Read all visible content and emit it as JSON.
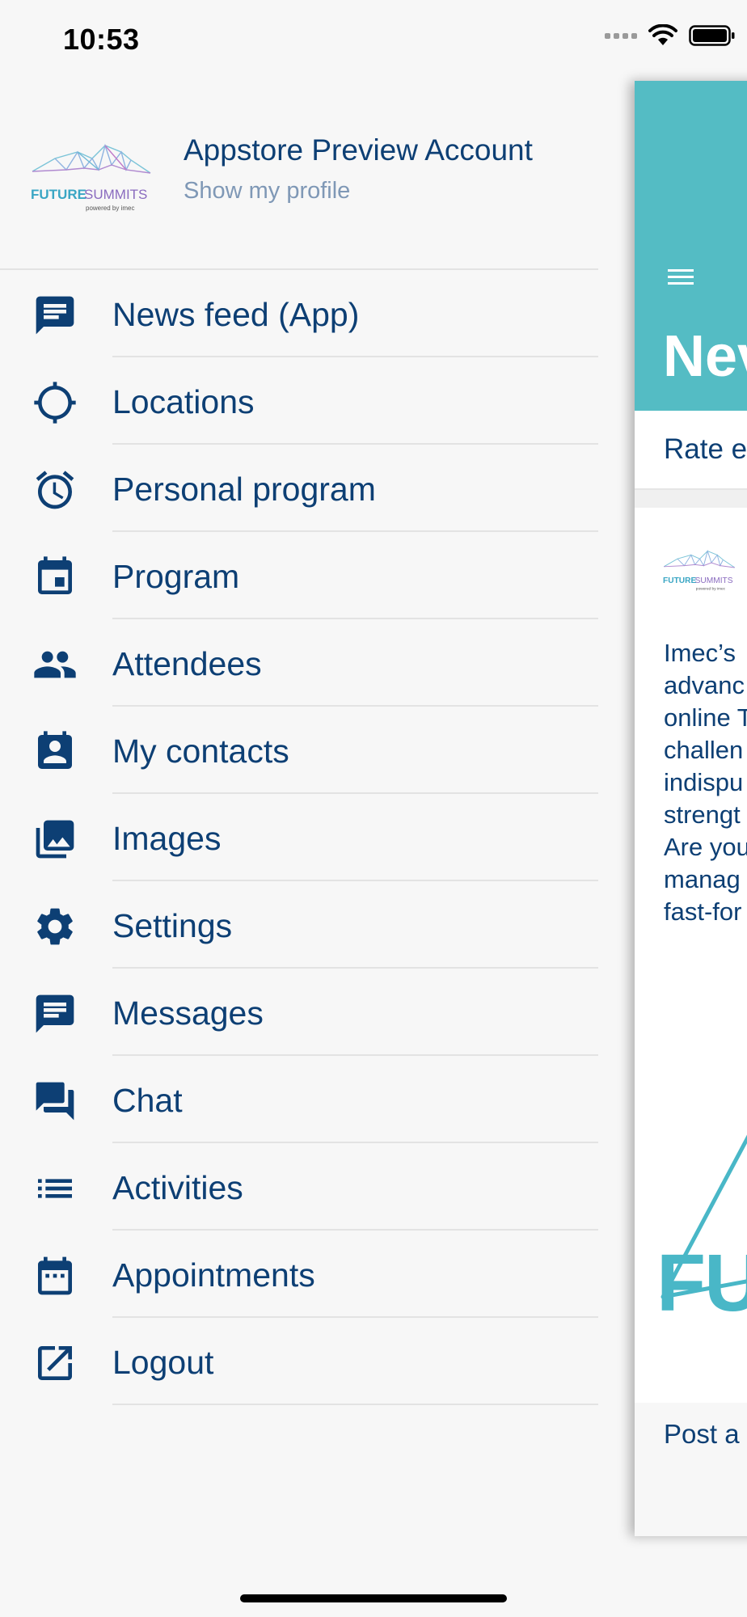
{
  "status_bar": {
    "time": "10:53"
  },
  "profile": {
    "name": "Appstore Preview Account",
    "link": "Show my profile",
    "logo_text": "FUTURESUMMITS",
    "logo_sub": "powered by imec"
  },
  "menu": [
    {
      "label": "News feed (App)",
      "icon": "news-feed-icon"
    },
    {
      "label": "Locations",
      "icon": "crosshair-icon"
    },
    {
      "label": "Personal program",
      "icon": "alarm-clock-icon"
    },
    {
      "label": "Program",
      "icon": "calendar-event-icon"
    },
    {
      "label": "Attendees",
      "icon": "people-icon"
    },
    {
      "label": "My contacts",
      "icon": "contact-card-icon"
    },
    {
      "label": "Images",
      "icon": "images-icon"
    },
    {
      "label": "Settings",
      "icon": "gear-icon"
    },
    {
      "label": "Messages",
      "icon": "message-icon"
    },
    {
      "label": "Chat",
      "icon": "chat-icon"
    },
    {
      "label": "Activities",
      "icon": "list-icon"
    },
    {
      "label": "Appointments",
      "icon": "calendar-icon"
    },
    {
      "label": "Logout",
      "icon": "external-link-icon"
    }
  ],
  "main_panel": {
    "title": "Nev",
    "subtab": "Rate e",
    "post_text": [
      "Imec’s",
      "advanc",
      "online T",
      "challen",
      "indispu",
      "strengt",
      "Are you",
      "manag",
      "fast-for"
    ],
    "post_big": "FU",
    "post_action": "Post a"
  },
  "colors": {
    "accent": "#54bcc4",
    "text": "#0d3f74",
    "muted": "#7f98b6",
    "background": "#f7f7f7"
  }
}
